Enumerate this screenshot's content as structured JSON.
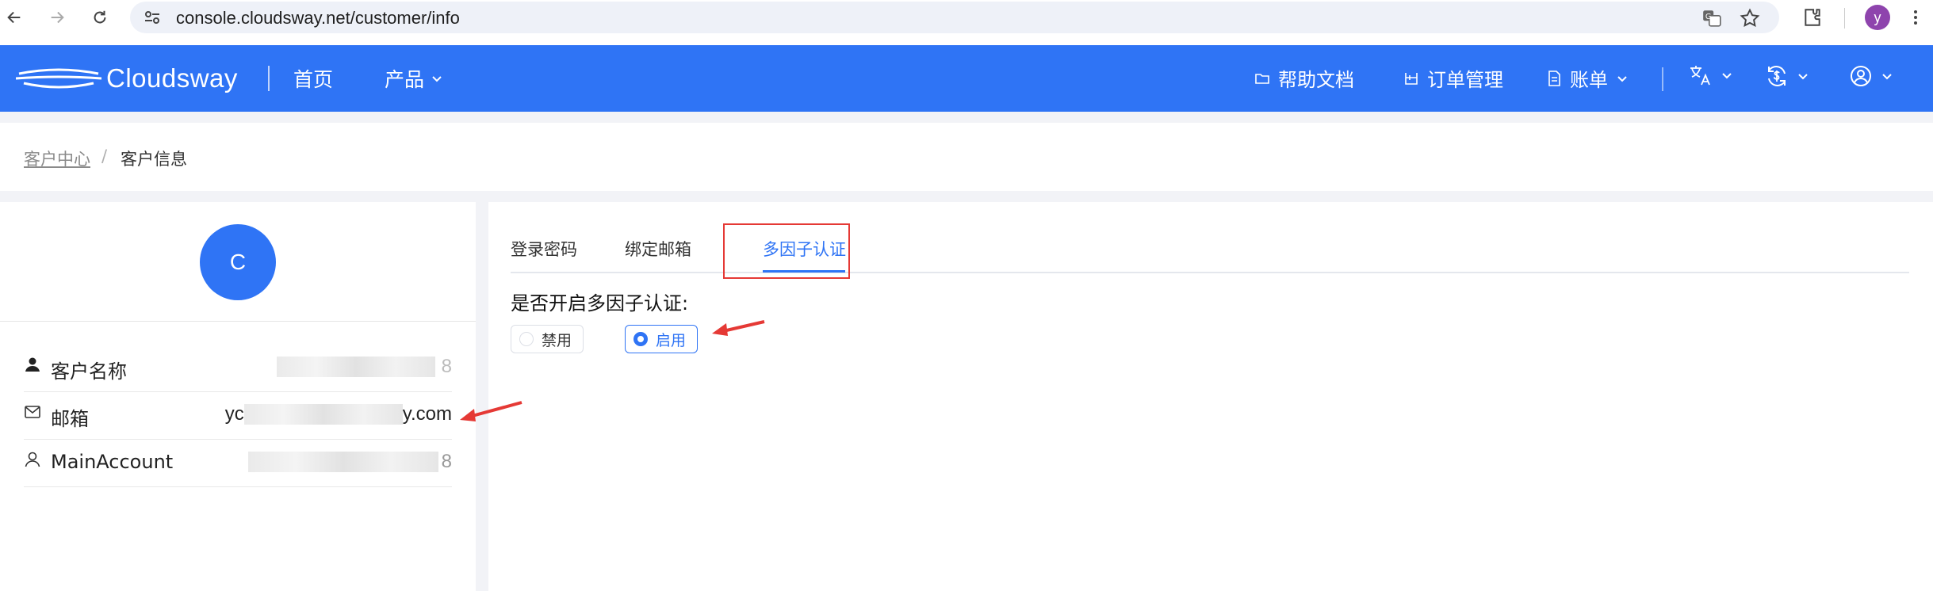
{
  "browser": {
    "url": "console.cloudsway.net/customer/info",
    "profile_initial": "y"
  },
  "header": {
    "logo_text": "Cloudsway",
    "nav_home": "首页",
    "nav_products": "产品",
    "help_docs": "帮助文档",
    "order_mgmt": "订单管理",
    "billing": "账单"
  },
  "breadcrumb": {
    "parent": "客户中心",
    "separator": "/",
    "current": "客户信息"
  },
  "profile": {
    "avatar_letter": "C",
    "rows": [
      {
        "label": "客户名称",
        "value_suffix": "8"
      },
      {
        "label": "邮箱",
        "value_prefix": "yc",
        "value_suffix": "y.com"
      },
      {
        "label": "MainAccount",
        "value_suffix": "8"
      }
    ]
  },
  "tabs": {
    "login_password": "登录密码",
    "bind_email": "绑定邮箱",
    "mfa": "多因子认证"
  },
  "mfa": {
    "question": "是否开启多因子认证:",
    "option_disable": "禁用",
    "option_enable": "启用",
    "selected": "启用"
  },
  "colors": {
    "brand_blue": "#2f74f5",
    "annotation_red": "#e53935"
  }
}
